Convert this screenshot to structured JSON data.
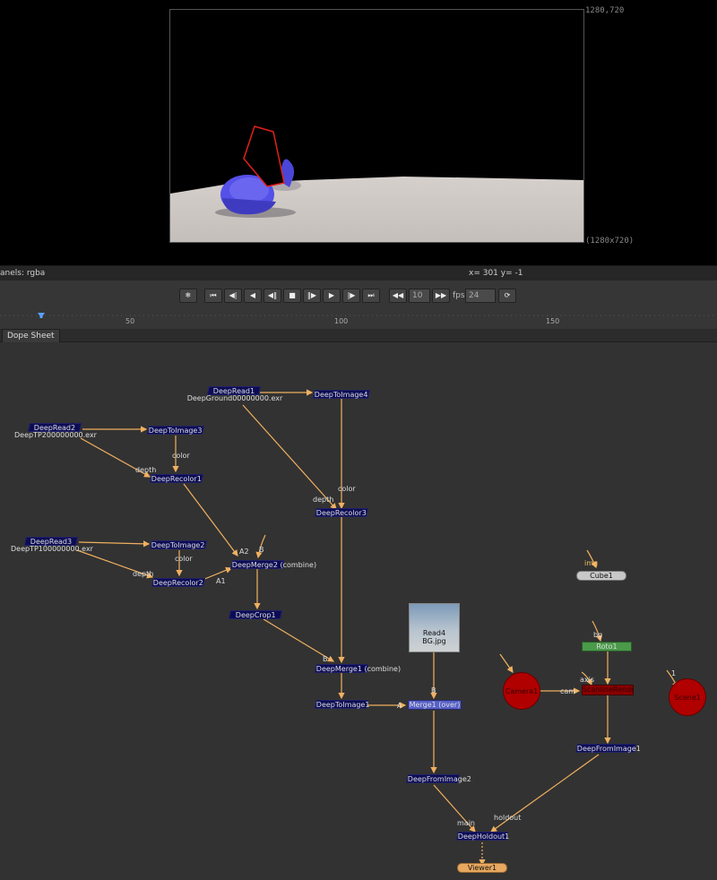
{
  "viewer": {
    "resolution_top": "1280,720",
    "resolution_bottom": "(1280x720)",
    "channels_label": "anels: rgba",
    "coords_label": "x= 301 y=  -1"
  },
  "transport": {
    "buttons": [
      "snowflake-icon",
      "first-frame-icon",
      "prev-keyframe-icon",
      "step-back-icon",
      "play-backward-icon",
      "stop-icon",
      "play-forward-icon",
      "step-forward-icon",
      "next-keyframe-icon",
      "last-frame-icon"
    ],
    "skip_value": "10",
    "fps_label": "fps",
    "fps_value": "24"
  },
  "timeline": {
    "ticks": [
      "50",
      "100",
      "150"
    ]
  },
  "tabs": {
    "dope_sheet": "Dope Sheet"
  },
  "nodes": {
    "deepread1": "DeepRead1",
    "deepread1_file": "DeepGround00000000.exr",
    "deeptoimage4": "DeepToImage4",
    "deepread2": "DeepRead2",
    "deepread2_file": "DeepTP200000000.exr",
    "deeptoimage3": "DeepToImage3",
    "deeprecolor1": "DeepRecolor1",
    "deeprecolor3": "DeepRecolor3",
    "deepread3": "DeepRead3",
    "deepread3_file": "DeepTP100000000.exr",
    "deeptoimage2": "DeepToImage2",
    "deeprecolor2": "DeepRecolor2",
    "deepmerge2": "DeepMerge2 (combine)",
    "deepcrop1": "DeepCrop1",
    "deepmerge1": "DeepMerge1 (combine)",
    "deeptoimage1": "DeepToImage1",
    "read4": "Read4",
    "read4_file": "BG.jpg",
    "merge1": "Merge1 (over)",
    "deepfromimage2": "DeepFromImage2",
    "deepholdout1": "DeepHoldout1",
    "viewer1": "Viewer1",
    "cube1": "Cube1",
    "roto1": "Roto1",
    "camera1": "Camera1",
    "scanline": "ScanlineRender1",
    "scene1": "Scene1",
    "deepfromimage1": "DeepFromImage1"
  },
  "edge_labels": {
    "color_a": "color",
    "depth_a": "depth",
    "color_b": "color",
    "depth_b": "depth",
    "color_c": "color",
    "depth_c": "depth",
    "a2": "A2",
    "b_merge2": "B",
    "a1": "A1",
    "b_merge1": "B",
    "a_merge": "A",
    "b_over": "B",
    "img": "img",
    "bg": "bg",
    "cam": "cam",
    "axis": "axis",
    "one": "1",
    "main": "main",
    "holdout": "holdout"
  },
  "colors": {
    "deep_node": "#0c0c55",
    "edge": "#f0b060",
    "camera": "#b00000",
    "roto": "#4a9a4a",
    "viewer_node": "#e8a860"
  }
}
